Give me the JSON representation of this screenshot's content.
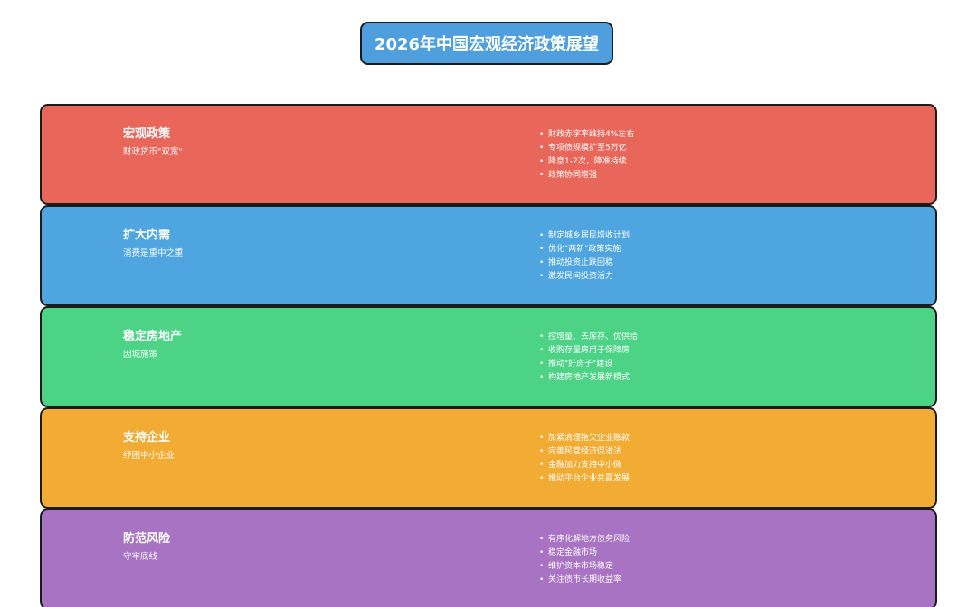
{
  "title": "2026年中国宏观经济政策展望",
  "colors": {
    "title_bg": "#4f9fdf",
    "border": "#1b1b1b"
  },
  "sections": [
    {
      "heading": "宏观政策",
      "subheading": "财政货币\"双宽\"",
      "color": "#e8675a",
      "points": [
        "财政赤字率维持4%左右",
        "专项债规模扩至5万亿",
        "降息1-2次，降准持续",
        "政策协同增强"
      ]
    },
    {
      "heading": "扩大内需",
      "subheading": "消费是重中之重",
      "color": "#4ea5e0",
      "points": [
        "制定城乡居民增收计划",
        "优化\"两新\"政策实施",
        "推动投资止跌回稳",
        "激发民间投资活力"
      ]
    },
    {
      "heading": "稳定房地产",
      "subheading": "因城施策",
      "color": "#4cd386",
      "points": [
        "控增量、去库存、优供给",
        "收购存量房用于保障房",
        "推动\"好房子\"建设",
        "构建房地产发展新模式"
      ]
    },
    {
      "heading": "支持企业",
      "subheading": "纾困中小企业",
      "color": "#f2ab33",
      "points": [
        "加紧清理拖欠企业账款",
        "完善民营经济促进法",
        "金融加力支持中小微",
        "推动平台企业共赢发展"
      ]
    },
    {
      "heading": "防范风险",
      "subheading": "守牢底线",
      "color": "#a773c2",
      "points": [
        "有序化解地方债务风险",
        "稳定金融市场",
        "维护资本市场稳定",
        "关注债市长期收益率"
      ]
    }
  ]
}
